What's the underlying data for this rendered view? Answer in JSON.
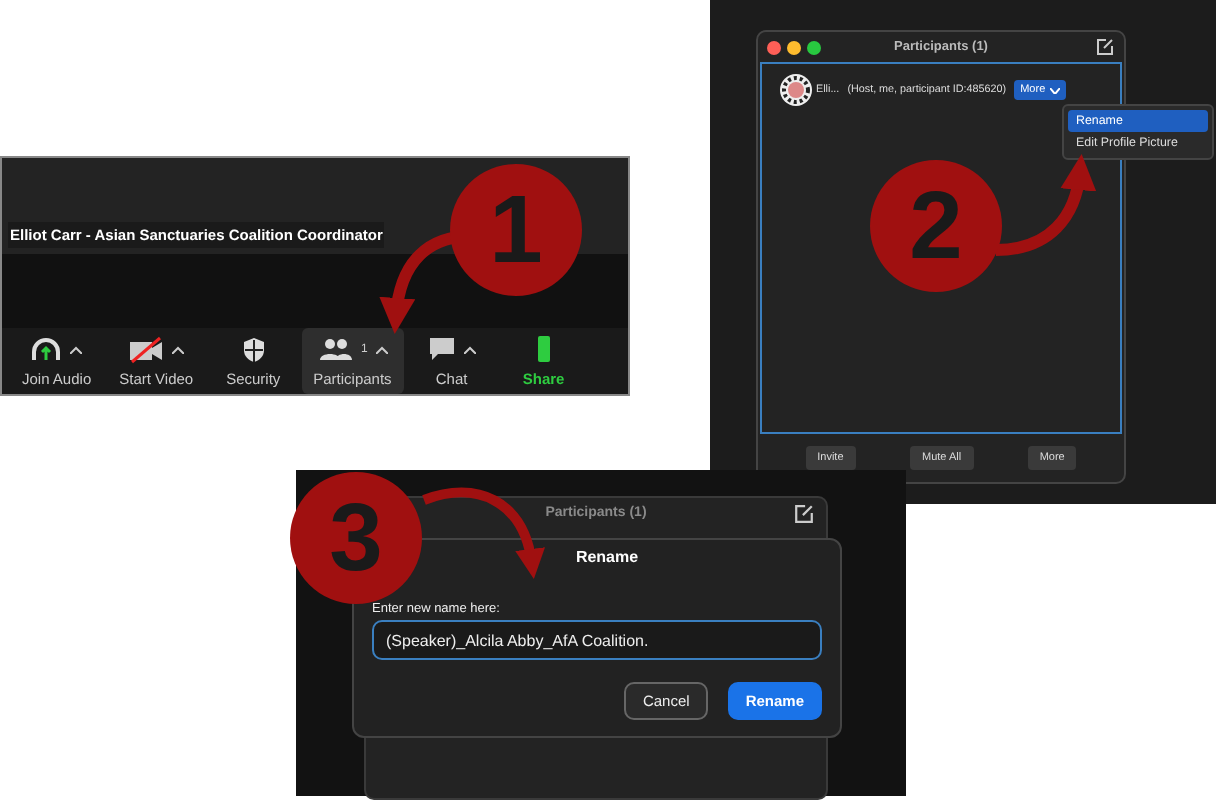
{
  "steps": [
    "1",
    "2",
    "3"
  ],
  "meeting": {
    "caption": "Elliot Carr - Asian Sanctuaries Coalition Coordinator",
    "toolbar": [
      {
        "kind": "audio",
        "label": "Join Audio",
        "selected": false
      },
      {
        "kind": "video",
        "label": "Start Video",
        "selected": false
      },
      {
        "kind": "security",
        "label": "Security",
        "selected": false
      },
      {
        "kind": "participants",
        "label": "Participants",
        "count": "1",
        "selected": true
      },
      {
        "kind": "chat",
        "label": "Chat",
        "selected": false
      },
      {
        "kind": "share",
        "label": "Share",
        "selected": false
      }
    ]
  },
  "participants_window": {
    "title": "Participants (1)",
    "participant": {
      "name": "Elli...",
      "detail": "(Host, me, participant ID:485620)",
      "more": "More"
    },
    "menu": [
      {
        "label": "Rename",
        "selected": true
      },
      {
        "label": "Edit Profile Picture",
        "selected": false
      }
    ],
    "footer": [
      "Invite",
      "Mute All",
      "More"
    ]
  },
  "rename_dialog": {
    "background_title": "Participants (1)",
    "title": "Rename",
    "label": "Enter new name here:",
    "value": "(Speaker)_Alcila Abby_AfA Coalition.",
    "buttons": [
      {
        "kind": "secondary",
        "label": "Cancel"
      },
      {
        "kind": "primary",
        "label": "Rename"
      }
    ]
  }
}
